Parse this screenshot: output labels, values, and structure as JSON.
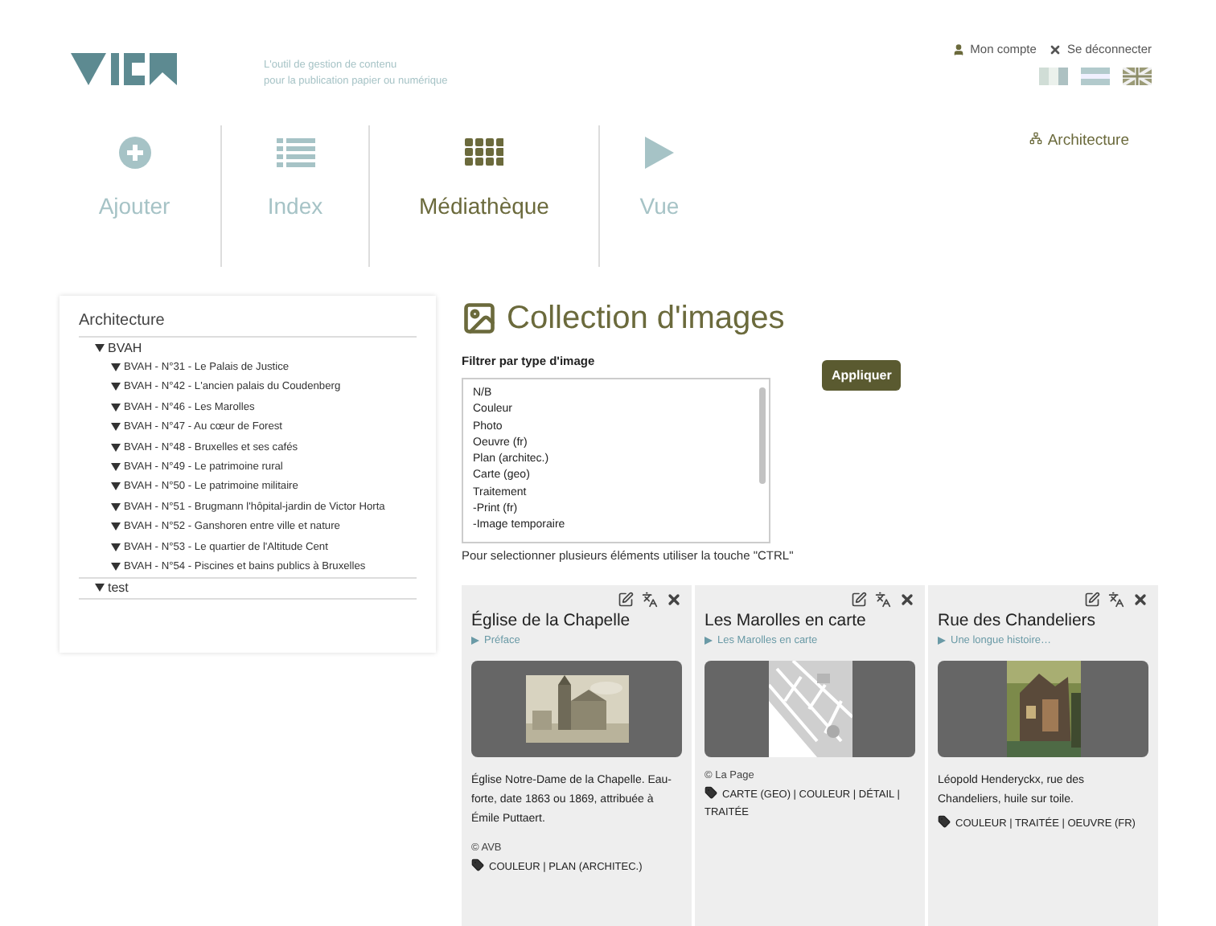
{
  "header": {
    "tagline": [
      "L'outil de gestion de contenu",
      "pour la publication papier ou numérique"
    ],
    "account_link": "Mon compte",
    "logout_link": "Se déconnecter",
    "languages": [
      {
        "kind": "nl",
        "selected": false
      },
      {
        "kind": "ar",
        "selected": false
      },
      {
        "kind": "uk",
        "selected": false
      }
    ]
  },
  "nav": [
    {
      "label": "Ajouter",
      "kind": "add",
      "selected": false
    },
    {
      "label": "Index",
      "kind": "list",
      "selected": false
    },
    {
      "label": "Médiathèque",
      "kind": "grid",
      "selected": true
    },
    {
      "label": "Vue",
      "kind": "play",
      "selected": false
    }
  ],
  "project_link": "Architecture",
  "sidebar": {
    "title": "Architecture",
    "tree": [
      {
        "label": "BVAH",
        "expanded": true,
        "children": [
          {
            "label": "BVAH - N°31 - Le Palais de Justice",
            "expanded": true
          },
          {
            "label": "BVAH - N°42 - L'ancien palais du Coudenberg",
            "expanded": true
          },
          {
            "label": "BVAH - N°46 - Les Marolles",
            "expanded": true
          },
          {
            "label": "BVAH - N°47 - Au cœur de Forest",
            "expanded": true
          },
          {
            "label": "BVAH - N°48 - Bruxelles et ses cafés",
            "expanded": true
          },
          {
            "label": "BVAH - N°49 - Le patrimoine rural",
            "expanded": true
          },
          {
            "label": "BVAH - N°50 - Le patrimoine militaire",
            "expanded": true
          },
          {
            "label": "BVAH - N°51 - Brugmann l'hôpital-jardin de Victor Horta",
            "expanded": true
          },
          {
            "label": "BVAH - N°52 - Ganshoren entre ville et nature",
            "expanded": true
          },
          {
            "label": "BVAH - N°53 - Le quartier de l'Altitude Cent",
            "expanded": true
          },
          {
            "label": "BVAH - N°54 - Piscines et bains publics à Bruxelles",
            "expanded": true
          }
        ]
      },
      {
        "label": "test",
        "expanded": true
      }
    ]
  },
  "main": {
    "title": "Collection d'images",
    "filter_label": "Filtrer par type d'image",
    "filter_options": [
      "N/B",
      "Couleur",
      "Photo",
      "Oeuvre (fr)",
      "Plan (architec.)",
      "Carte (geo)",
      "Traitement",
      "-Print (fr)",
      "-Image temporaire"
    ],
    "apply_button": "Appliquer",
    "hint": "Pour selectionner plusieurs éléments utiliser la touche \"CTRL\""
  },
  "cards": [
    {
      "title": "Église de la Chapelle",
      "link": "Préface",
      "kind": "sketch",
      "caption": "Église Notre-Dame de la Chapelle. Eau-forte, date 1863 ou 1869, attribuée à Émile Puttaert.",
      "credit": "© AVB",
      "tags": "COULEUR | PLAN (ARCHITEC.)"
    },
    {
      "title": "Les Marolles en carte",
      "link": "Les Marolles en carte",
      "kind": "map",
      "credit": "© La Page",
      "tags": "CARTE (GEO) | COULEUR | DÉTAIL | TRAITÉE"
    },
    {
      "title": "Rue des Chandeliers",
      "link": "Une longue histoire…",
      "kind": "painting",
      "caption": "Léopold Henderyckx, rue des Chandeliers, huile sur toile.",
      "tags": "COULEUR | TRAITÉE | OEUVRE (FR)"
    }
  ]
}
